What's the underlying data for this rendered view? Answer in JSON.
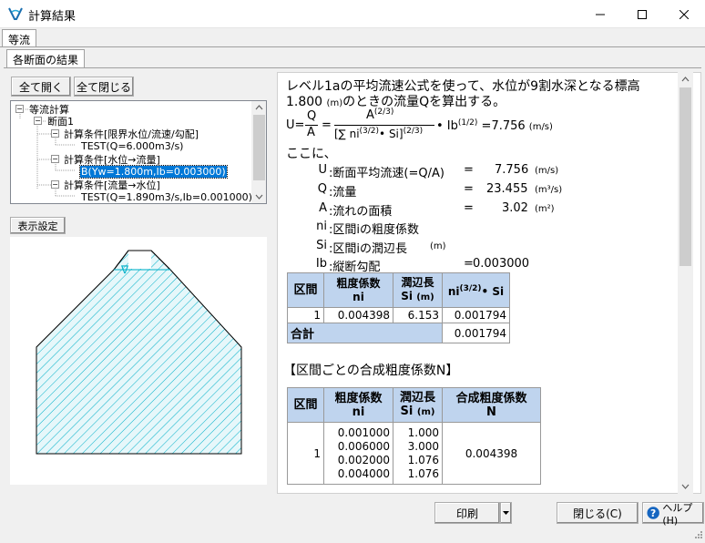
{
  "window": {
    "title": "計算結果"
  },
  "tabs": {
    "outer": "等流",
    "inner": "各断面の結果"
  },
  "buttons": {
    "expand_all": "全て開く",
    "collapse_all": "全て閉じる",
    "display_settings": "表示設定",
    "print": "印刷",
    "close": "閉じる(C)",
    "help": "ヘルプ(H)"
  },
  "tree": {
    "root": "等流計算",
    "section": "断面1",
    "cond1": "計算条件[限界水位/流速/勾配]",
    "cond1_child": "TEST(Q=6.000m3/s)",
    "cond2": "計算条件[水位→流量]",
    "cond2_child": "B(Yw=1.800m,Ib=0.003000)",
    "cond3": "計算条件[流量→水位]",
    "cond3_child": "TEST(Q=1.890m3/s,Ib=0.001000)"
  },
  "result": {
    "intro_line1": "レベル1aの平均流速公式を使って、水位が9割水深となる標高",
    "intro_line2_value": "1.800",
    "intro_line2_unit": "(m)",
    "intro_line2_rest": "のときの流量Qを算出する。",
    "formula": {
      "lhs": "U=",
      "q": "Q",
      "a": "A",
      "eq": "=",
      "num_a": "A",
      "num_exp": "(2/3)",
      "den": "[∑ ni",
      "den_exp1": "(3/2)",
      "den_mid": "• Si]",
      "den_exp2": "(2/3)",
      "ib": "• Ib",
      "ib_exp": "(1/2)",
      "result": "=7.756",
      "unit": "(m/s)"
    },
    "koko": "ここに、",
    "defs": [
      {
        "sym": "U",
        "desc": ":断面平均流速(=Q/A)",
        "eq": "=",
        "val": "7.756",
        "unit": "(m/s)"
      },
      {
        "sym": "Q",
        "desc": ":流量",
        "eq": "=",
        "val": "23.455",
        "unit": "(m³/s)"
      },
      {
        "sym": "A",
        "desc": ":流れの面積",
        "eq": "=",
        "val": "3.02",
        "unit": "(m²)"
      },
      {
        "sym": "ni",
        "desc": ":区間iの粗度係数",
        "eq": "",
        "val": "",
        "unit": ""
      },
      {
        "sym": "Si",
        "desc": ":区間iの潤辺長",
        "eq": "",
        "val": "",
        "unit": "(m)"
      },
      {
        "sym": "Ib",
        "desc": ":縦断勾配",
        "eq": "=",
        "val": "0.003000",
        "unit": ""
      }
    ],
    "table1": {
      "h_section": "区間",
      "h_rough": "粗度係数",
      "h_rough_sub": "ni",
      "h_per": "潤辺長",
      "h_per_sub": "Si",
      "h_per_unit": "(m)",
      "h_prod": "ni",
      "h_prod_exp": "(3/2)",
      "h_prod_tail": "• Si",
      "row_section": "1",
      "row_ni": "0.004398",
      "row_si": "6.153",
      "row_prod": "0.001794",
      "total_label": "合計",
      "total_value": "0.001794"
    },
    "heading2": "【区間ごとの合成粗度係数N】",
    "table2": {
      "h_section": "区間",
      "h_rough": "粗度係数",
      "h_rough_sub": "ni",
      "h_per": "潤辺長",
      "h_per_sub": "Si",
      "h_per_unit": "(m)",
      "h_comp": "合成粗度係数",
      "h_comp_sub": "N",
      "row_section": "1",
      "ni_values": [
        "0.001000",
        "0.006000",
        "0.002000",
        "0.004000"
      ],
      "si_values": [
        "1.000",
        "3.000",
        "1.076",
        "1.076"
      ],
      "composite": "0.004398"
    }
  },
  "drawing": {
    "water_label": "∇"
  },
  "colors": {
    "hatch": "#00b0c8",
    "water_fill": "#e6f7fa",
    "table_header": "#bfd4ee",
    "selection": "#0078d7"
  }
}
